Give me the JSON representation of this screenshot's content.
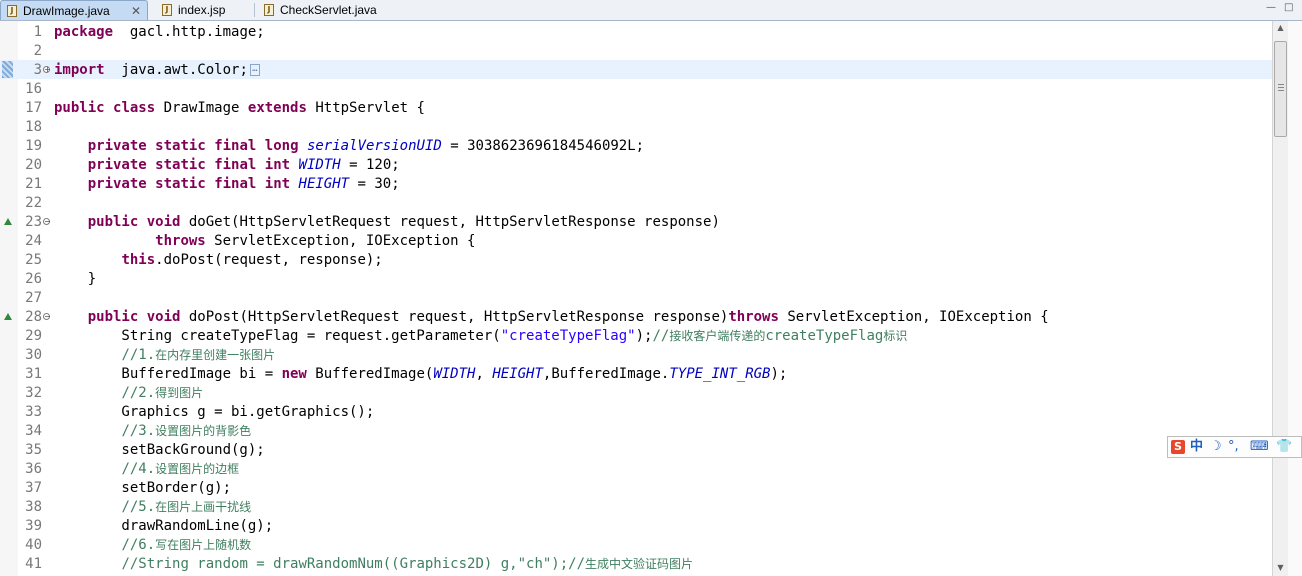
{
  "tabs": [
    {
      "label": "DrawImage.java",
      "active": true,
      "icon": "java-file-icon",
      "close": "✕"
    },
    {
      "label": "index.jsp",
      "active": false,
      "icon": "jsp-file-icon"
    },
    {
      "label": "CheckServlet.java",
      "active": false,
      "icon": "java-file-icon"
    }
  ],
  "window_controls": {
    "minimize": "—",
    "maximize": "□"
  },
  "colors": {
    "keyword": "#7f0055",
    "field": "#0000c0",
    "string": "#2a00ff",
    "comment": "#3f7f5f"
  },
  "lines": [
    {
      "n": "1",
      "parts": [
        [
          "kw",
          "package"
        ],
        [
          "",
          "  gacl.http.image;"
        ]
      ]
    },
    {
      "n": "2",
      "parts": []
    },
    {
      "n": "3",
      "parts": [
        [
          "kw",
          "import"
        ],
        [
          "",
          "  java.awt.Color;"
        ]
      ],
      "fold": "+",
      "collapsed": true
    },
    {
      "n": "16",
      "parts": []
    },
    {
      "n": "17",
      "parts": [
        [
          "kw",
          "public"
        ],
        [
          "",
          " "
        ],
        [
          "kw",
          "class"
        ],
        [
          "",
          " DrawImage "
        ],
        [
          "kw",
          "extends"
        ],
        [
          "",
          " HttpServlet {"
        ]
      ]
    },
    {
      "n": "18",
      "parts": []
    },
    {
      "n": "19",
      "parts": [
        [
          "",
          "    "
        ],
        [
          "kw",
          "private"
        ],
        [
          "",
          " "
        ],
        [
          "kw",
          "static"
        ],
        [
          "",
          " "
        ],
        [
          "kw",
          "final"
        ],
        [
          "",
          " "
        ],
        [
          "kw",
          "long"
        ],
        [
          "",
          " "
        ],
        [
          "fld",
          "serialVersionUID"
        ],
        [
          "",
          " = 3038623696184546092L;"
        ]
      ]
    },
    {
      "n": "20",
      "parts": [
        [
          "",
          "    "
        ],
        [
          "kw",
          "private"
        ],
        [
          "",
          " "
        ],
        [
          "kw",
          "static"
        ],
        [
          "",
          " "
        ],
        [
          "kw",
          "final"
        ],
        [
          "",
          " "
        ],
        [
          "kw",
          "int"
        ],
        [
          "",
          " "
        ],
        [
          "fld",
          "WIDTH"
        ],
        [
          "",
          " = 120;"
        ]
      ]
    },
    {
      "n": "21",
      "parts": [
        [
          "",
          "    "
        ],
        [
          "kw",
          "private"
        ],
        [
          "",
          " "
        ],
        [
          "kw",
          "static"
        ],
        [
          "",
          " "
        ],
        [
          "kw",
          "final"
        ],
        [
          "",
          " "
        ],
        [
          "kw",
          "int"
        ],
        [
          "",
          " "
        ],
        [
          "fld",
          "HEIGHT"
        ],
        [
          "",
          " = 30;"
        ]
      ]
    },
    {
      "n": "22",
      "parts": []
    },
    {
      "n": "23",
      "parts": [
        [
          "",
          "    "
        ],
        [
          "kw",
          "public"
        ],
        [
          "",
          " "
        ],
        [
          "kw",
          "void"
        ],
        [
          "",
          " doGet(HttpServletRequest request, HttpServletResponse response)"
        ]
      ],
      "fold": "−",
      "override": true
    },
    {
      "n": "24",
      "parts": [
        [
          "",
          "            "
        ],
        [
          "kw",
          "throws"
        ],
        [
          "",
          " ServletException, IOException {"
        ]
      ]
    },
    {
      "n": "25",
      "parts": [
        [
          "",
          "        "
        ],
        [
          "kw",
          "this"
        ],
        [
          "",
          ".doPost(request, response);"
        ]
      ]
    },
    {
      "n": "26",
      "parts": [
        [
          "",
          "    }"
        ]
      ]
    },
    {
      "n": "27",
      "parts": []
    },
    {
      "n": "28",
      "parts": [
        [
          "",
          "    "
        ],
        [
          "kw",
          "public"
        ],
        [
          "",
          " "
        ],
        [
          "kw",
          "void"
        ],
        [
          "",
          " doPost(HttpServletRequest request, HttpServletResponse response)"
        ],
        [
          "kw",
          "throws"
        ],
        [
          "",
          " ServletException, IOException {"
        ]
      ],
      "fold": "−",
      "override": true
    },
    {
      "n": "29",
      "parts": [
        [
          "",
          "        String createTypeFlag = request.getParameter("
        ],
        [
          "str",
          "\"createTypeFlag\""
        ],
        [
          "",
          ");"
        ],
        [
          "cmt",
          "//"
        ],
        [
          "cmtcjk",
          "接收客户端传递的"
        ],
        [
          "cmt",
          "createTypeFlag"
        ],
        [
          "cmtcjk",
          "标识"
        ]
      ]
    },
    {
      "n": "30",
      "parts": [
        [
          "",
          "        "
        ],
        [
          "cmt",
          "//1."
        ],
        [
          "cmtcjk",
          "在内存里创建一张图片"
        ]
      ]
    },
    {
      "n": "31",
      "parts": [
        [
          "",
          "        BufferedImage bi = "
        ],
        [
          "kw",
          "new"
        ],
        [
          "",
          " BufferedImage("
        ],
        [
          "fld",
          "WIDTH"
        ],
        [
          "",
          ", "
        ],
        [
          "fld",
          "HEIGHT"
        ],
        [
          "",
          ",BufferedImage."
        ],
        [
          "fld",
          "TYPE_INT_RGB"
        ],
        [
          "",
          ");"
        ]
      ]
    },
    {
      "n": "32",
      "parts": [
        [
          "",
          "        "
        ],
        [
          "cmt",
          "//2."
        ],
        [
          "cmtcjk",
          "得到图片"
        ]
      ]
    },
    {
      "n": "33",
      "parts": [
        [
          "",
          "        Graphics g = bi.getGraphics();"
        ]
      ]
    },
    {
      "n": "34",
      "parts": [
        [
          "",
          "        "
        ],
        [
          "cmt",
          "//3."
        ],
        [
          "cmtcjk",
          "设置图片的背影色"
        ]
      ]
    },
    {
      "n": "35",
      "parts": [
        [
          "",
          "        setBackGround(g);"
        ]
      ]
    },
    {
      "n": "36",
      "parts": [
        [
          "",
          "        "
        ],
        [
          "cmt",
          "//4."
        ],
        [
          "cmtcjk",
          "设置图片的边框"
        ]
      ]
    },
    {
      "n": "37",
      "parts": [
        [
          "",
          "        setBorder(g);"
        ]
      ]
    },
    {
      "n": "38",
      "parts": [
        [
          "",
          "        "
        ],
        [
          "cmt",
          "//5."
        ],
        [
          "cmtcjk",
          "在图片上画干扰线"
        ]
      ]
    },
    {
      "n": "39",
      "parts": [
        [
          "",
          "        drawRandomLine(g);"
        ]
      ]
    },
    {
      "n": "40",
      "parts": [
        [
          "",
          "        "
        ],
        [
          "cmt",
          "//6."
        ],
        [
          "cmtcjk",
          "写在图片上随机数"
        ]
      ]
    },
    {
      "n": "41",
      "parts": [
        [
          "",
          "        "
        ],
        [
          "cmt",
          "//String random = drawRandomNum((Graphics2D) g,\"ch\");//"
        ],
        [
          "cmtcjk",
          "生成中文验证码图片"
        ]
      ]
    }
  ],
  "ime": {
    "logo": "S",
    "lang": "中",
    "moon": "☽",
    "punct": "°,",
    "keyboard": "⌨",
    "shirt": "👕"
  }
}
